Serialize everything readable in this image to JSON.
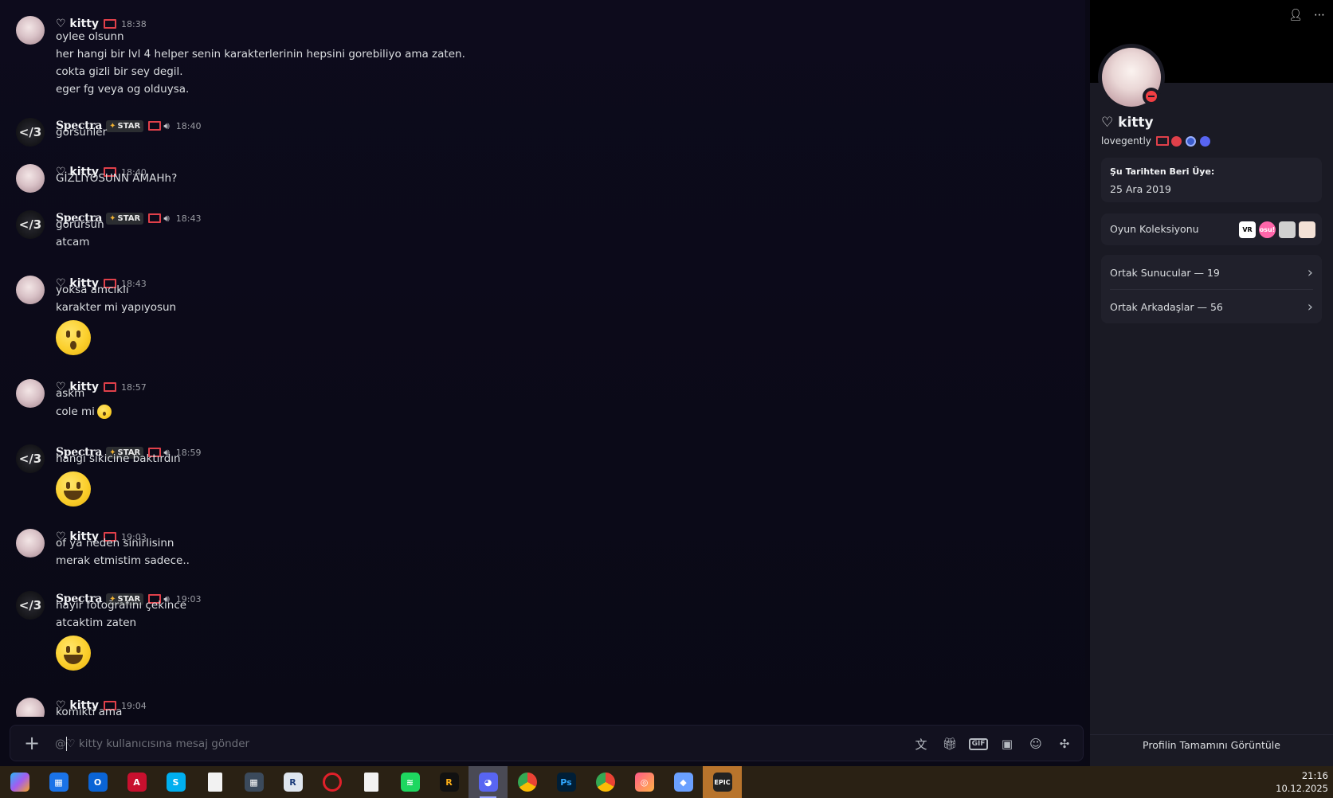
{
  "chat": {
    "groups": [
      {
        "user": "♡ kitty",
        "kind": "kitty",
        "time": "18:38",
        "lines": [
          "oylee olsunn",
          "her hangi bir lvl 4 helper senin karakterlerinin hepsini gorebiliyo ama zaten.",
          "cokta gizli bir sey degil.",
          "eger fg veya og olduysa."
        ]
      },
      {
        "user": "Spectra",
        "kind": "spectra",
        "badge": "STAR",
        "time": "18:40",
        "lines": [
          "görsünler"
        ]
      },
      {
        "user": "♡ kitty",
        "kind": "kitty",
        "time": "18:40",
        "lines": [
          "GİZLİYOSUNN AMAHh?"
        ]
      },
      {
        "user": "Spectra",
        "kind": "spectra",
        "badge": "STAR",
        "time": "18:43",
        "lines": [
          "görürsün",
          "atcam"
        ]
      },
      {
        "user": "♡ kitty",
        "kind": "kitty",
        "time": "18:43",
        "lines": [
          "yoksa amcıklı",
          "karakter mi yapıyosun"
        ],
        "emoji": "hushed-face-emoji"
      },
      {
        "user": "♡ kitty",
        "kind": "kitty",
        "time": "18:57",
        "lines": [
          "askm",
          "cole mi"
        ],
        "inline_emoji": "hushed-face-emoji"
      },
      {
        "user": "Spectra",
        "kind": "spectra",
        "badge": "STAR",
        "time": "18:59",
        "lines": [
          "hangi sikicine baktırdın"
        ],
        "emoji": "smiley-emoji"
      },
      {
        "user": "♡ kitty",
        "kind": "kitty",
        "time": "19:03",
        "lines": [
          "of ya neden sinirlisinn",
          "merak etmistim sadece.."
        ]
      },
      {
        "user": "Spectra",
        "kind": "spectra",
        "badge": "STAR",
        "time": "19:03",
        "lines": [
          "hayir fotoğrafını çekince",
          "atcaktim zaten"
        ],
        "emoji": "smiley-emoji"
      },
      {
        "user": "♡ kitty",
        "kind": "kitty",
        "time": "19:04",
        "lines": [
          "komikti ama"
        ]
      }
    ],
    "spectra_avatar_text": "</3"
  },
  "composer": {
    "placeholder": "@♡ kitty kullanıcısına mesaj gönder",
    "tools": [
      "translate-icon",
      "gift-icon",
      "gif-icon",
      "sticker-icon",
      "emoji-icon",
      "apps-icon"
    ]
  },
  "profile": {
    "display_name": "♡ kitty",
    "username": "lovegently",
    "member_since_label": "Şu Tarihten Beri Üye:",
    "member_since_value": "25 Ara 2019",
    "games_label": "Oyun Koleksiyonu",
    "mutual_servers": "Ortak Sunucular — 19",
    "mutual_friends": "Ortak Arkadaşlar — 56",
    "full_profile": "Profilin Tamamını Görüntüle",
    "game_vr": "VR",
    "game_osu": "osu!"
  },
  "taskbar": {
    "apps": [
      "copilot-icon",
      "store-icon",
      "outlook-icon",
      "autocad-icon",
      "skype-icon",
      "file-icon",
      "calculator-icon",
      "r-app-icon",
      "opera-icon",
      "file-icon-2",
      "spotify-icon",
      "rockstar-icon",
      "discord-icon",
      "chrome-icon",
      "photoshop-icon",
      "chrome-profile-icon",
      "camera-app-icon",
      "package-icon",
      "epic-games-icon"
    ],
    "time": "21:16",
    "date": "10.12.2025"
  }
}
